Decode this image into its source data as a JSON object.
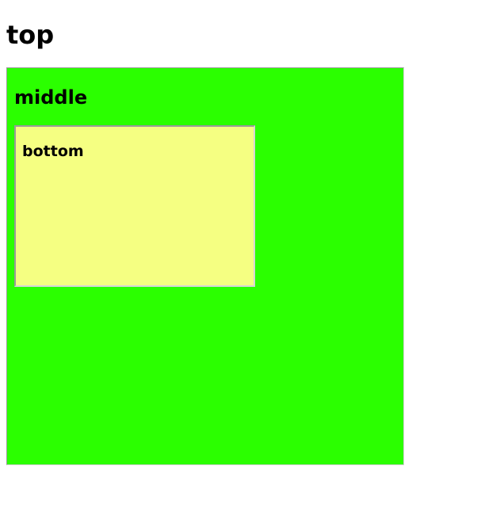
{
  "top": {
    "label": "top"
  },
  "middle": {
    "label": "middle",
    "background": "#2bff00"
  },
  "bottom": {
    "label": "bottom",
    "background": "#f5ff82"
  }
}
